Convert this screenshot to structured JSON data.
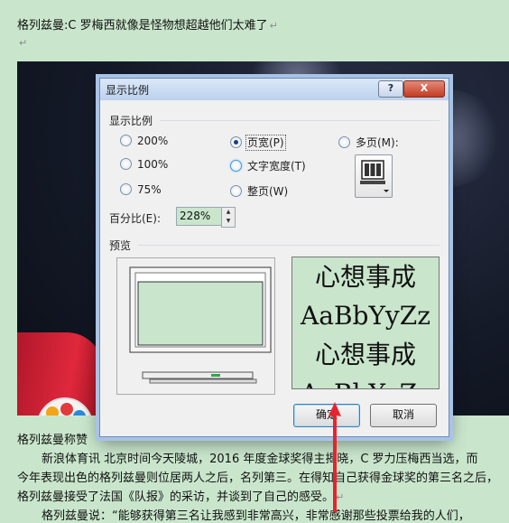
{
  "document": {
    "line1": "格列兹曼:C 罗梅西就像是怪物想超越他们太难了",
    "caption": "格列兹曼称赞",
    "para1": "新浪体育讯    北京时间今天陵城，2016 年度金球奖得主揭晓，C 罗力压梅西当选，而",
    "para2": "今年表现出色的格列兹曼则位居两人之后，名列第三。在得知自己获得金球奖的第三名之后，",
    "para3": "格列兹曼接受了法国《队报》的采访，并谈到了自己的感受。",
    "para4": "格列兹曼说：“能够获得第三名让我感到非常高兴，非常感谢那些投票给我的人们，"
  },
  "dialog": {
    "title": "显示比例",
    "help_symbol": "?",
    "close_symbol": "X",
    "group_zoom": "显示比例",
    "options": {
      "p200": "200%",
      "p100": "100%",
      "p75": "75%",
      "page_width": "页宽(P)",
      "text_width": "文字宽度(T)",
      "whole_page": "整页(W)",
      "many_pages": "多页(M):"
    },
    "selected": "page_width",
    "percent_label": "百分比(E):",
    "percent_value": "228%",
    "preview_label": "预览",
    "preview_lines": [
      "心想事成",
      "AaBbYyZz",
      "心想事成",
      "AaBbYyZz"
    ],
    "ok_label": "确定",
    "cancel_label": "取消"
  },
  "colors": {
    "page_bg": "#c9e6cc",
    "arrow": "#e8232e"
  }
}
